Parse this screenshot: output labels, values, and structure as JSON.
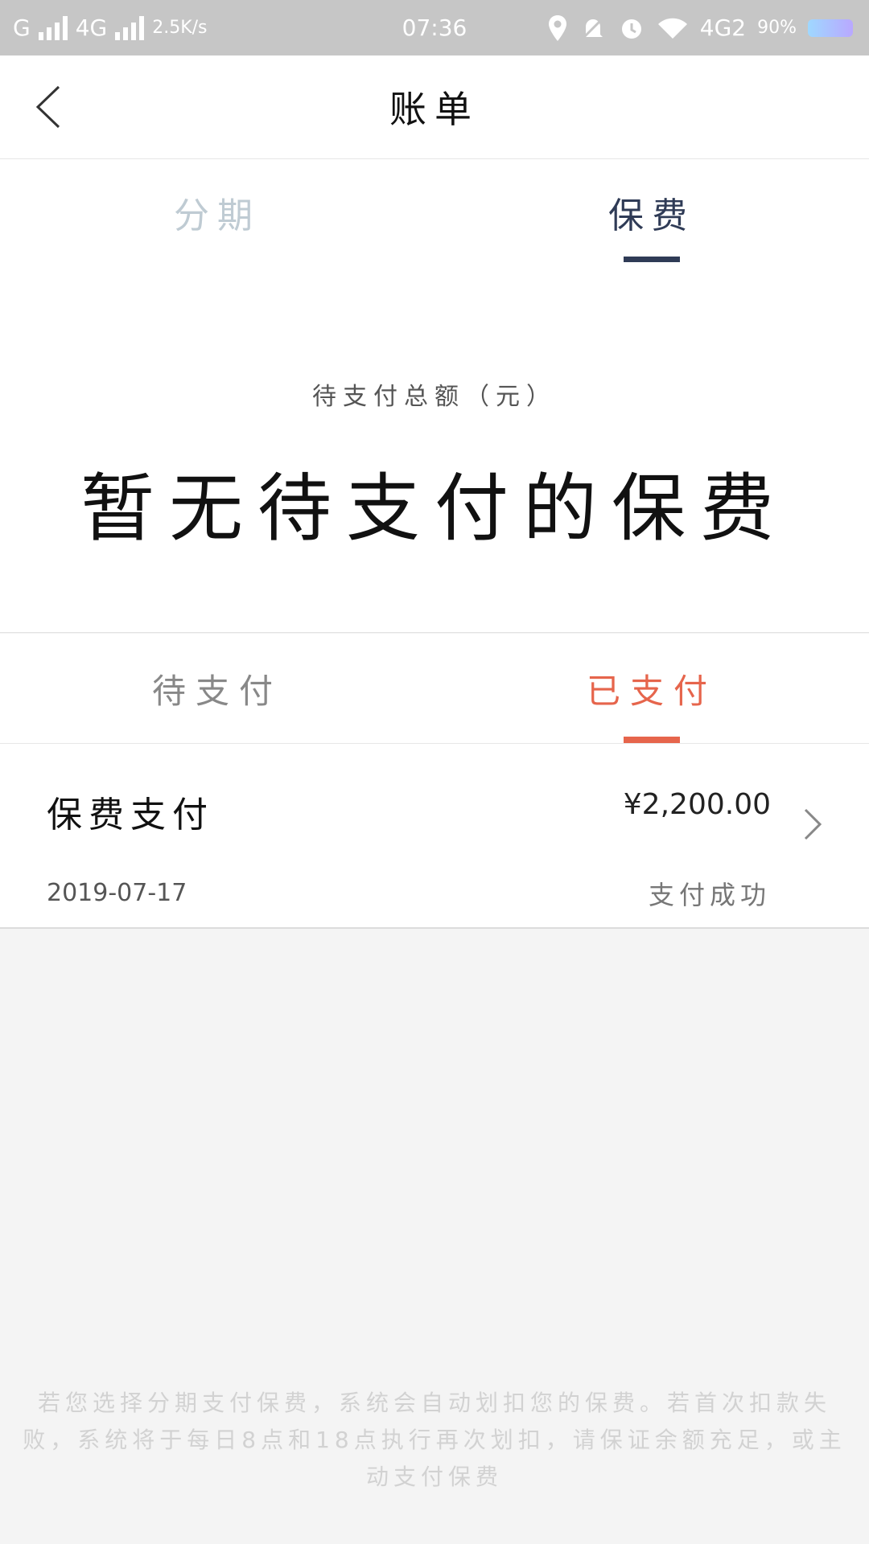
{
  "status_bar": {
    "carrier1": "G",
    "carrier2": "4G",
    "speed": "2.5K/s",
    "time": "07:36",
    "network": "4G2",
    "battery": "90%"
  },
  "navbar": {
    "title": "账单"
  },
  "top_tabs": {
    "left": "分期",
    "right": "保费",
    "active": "right"
  },
  "summary": {
    "label": "待支付总额（元）",
    "main": "暂无待支付的保费"
  },
  "sub_tabs": {
    "left": "待支付",
    "right": "已支付",
    "active": "right"
  },
  "records": [
    {
      "title": "保费支付",
      "amount": "¥2,200.00",
      "date": "2019-07-17",
      "status": "支付成功"
    }
  ],
  "footer": {
    "note": "若您选择分期支付保费，系统会自动划扣您的保费。若首次扣款失败，系统将于每日8点和18点执行再次划扣，请保证余额充足，或主动支付保费"
  },
  "colors": {
    "accent_red": "#e6654c",
    "tab_dark": "#2f3b56",
    "tab_inactive": "#bfcbd3"
  }
}
